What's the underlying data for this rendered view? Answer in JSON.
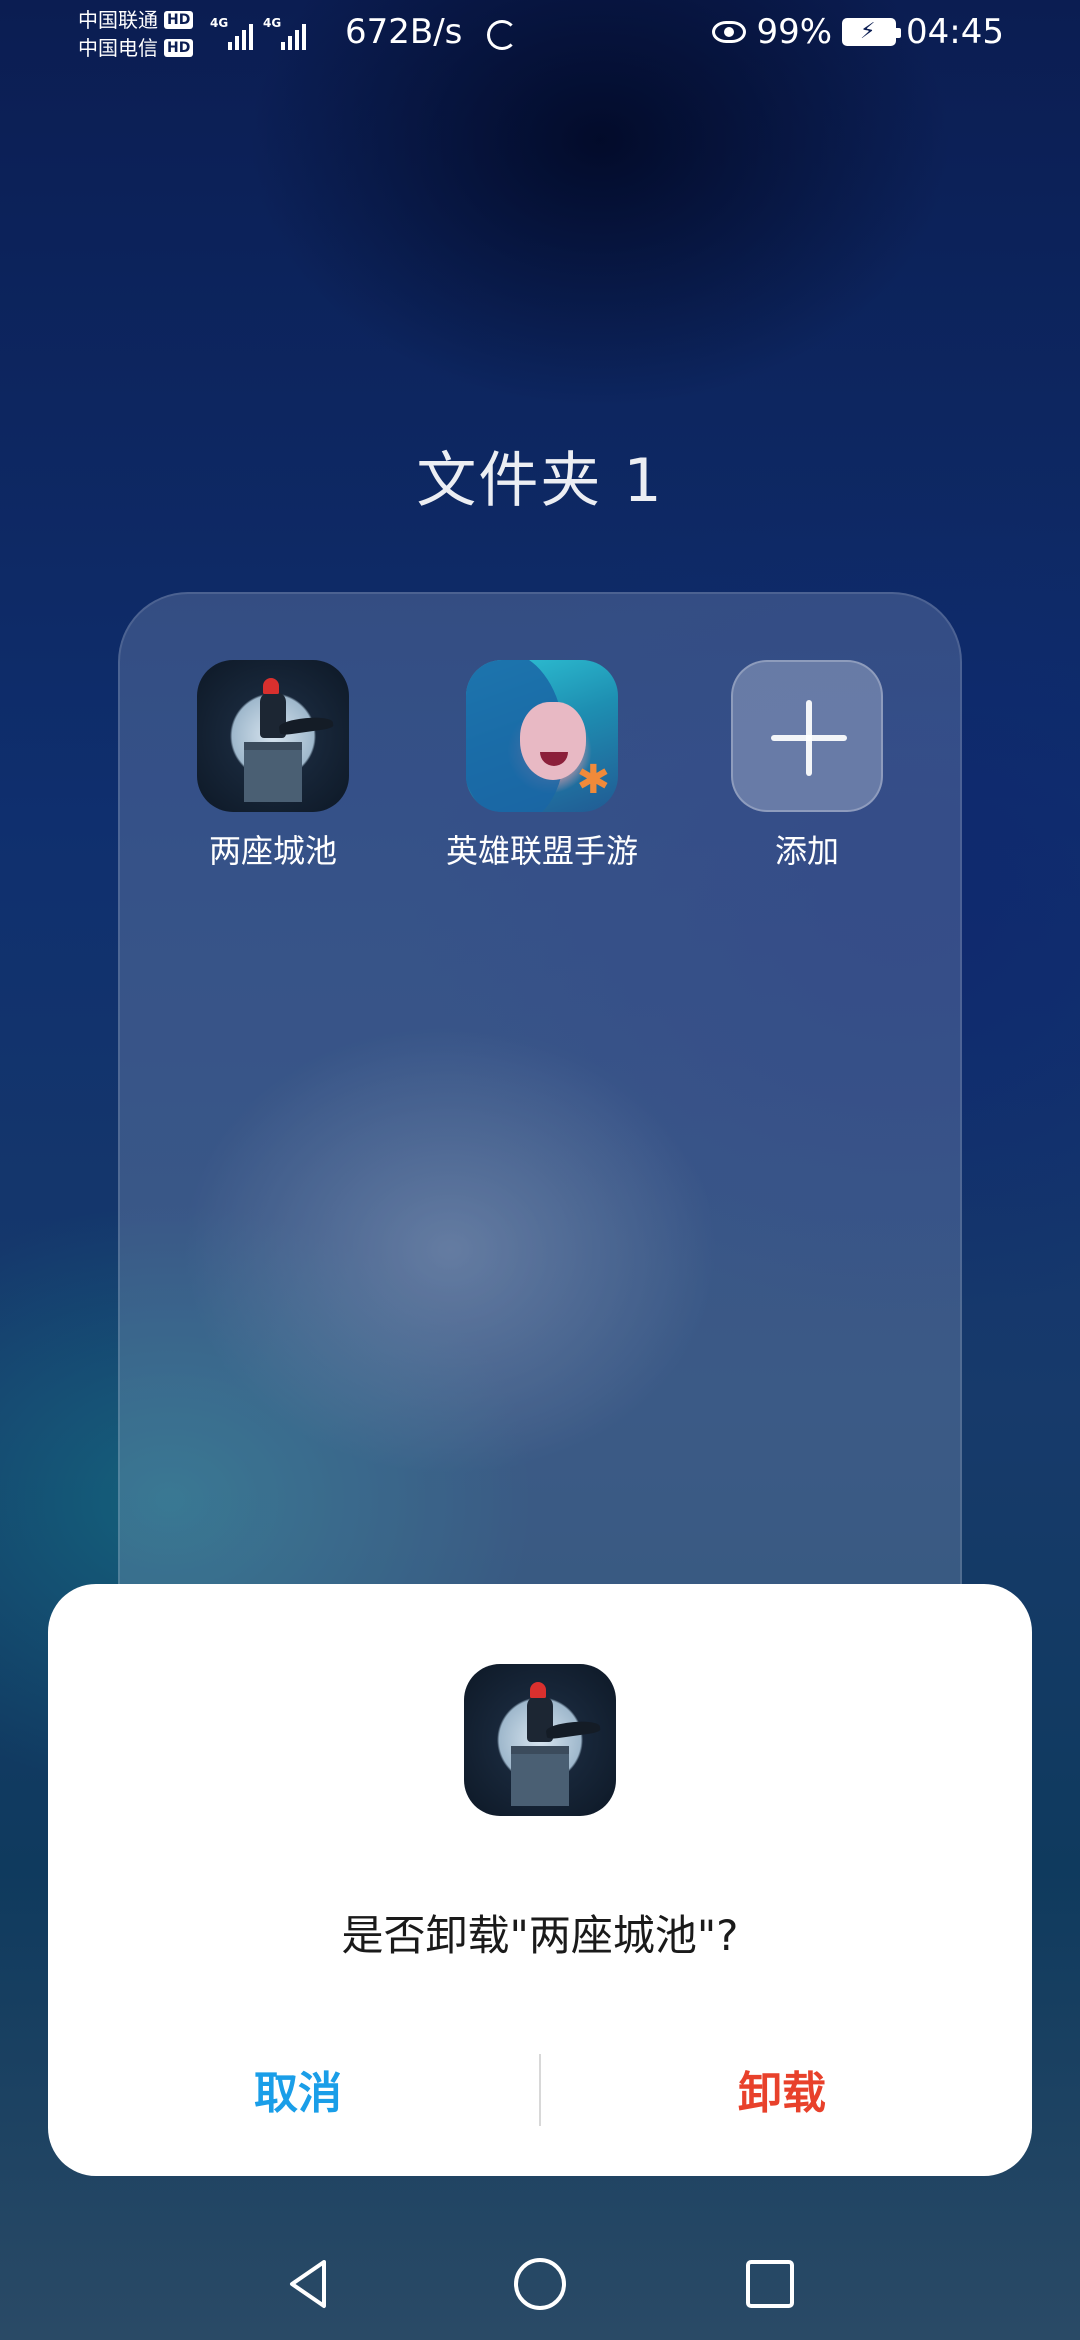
{
  "status_bar": {
    "carrier1": "中国联通",
    "carrier2": "中国电信",
    "hd_badge": "HD",
    "network_type": "4G",
    "net_speed": "672B/s",
    "battery": "99%",
    "time": "04:45"
  },
  "folder": {
    "title": "文件夹 1",
    "apps": [
      {
        "label": "两座城池",
        "icon": "castle-game-icon"
      },
      {
        "label": "英雄联盟手游",
        "icon": "lol-mobile-icon"
      },
      {
        "label": "添加",
        "icon": "plus-icon"
      }
    ]
  },
  "dialog": {
    "message": "是否卸载\"两座城池\"?",
    "cancel_label": "取消",
    "confirm_label": "卸载",
    "cancel_color": "#1a9ee8",
    "confirm_color": "#e8412b"
  },
  "nav": {
    "back_icon": "back-triangle-icon",
    "home_icon": "home-circle-icon",
    "recent_icon": "recent-square-icon"
  }
}
